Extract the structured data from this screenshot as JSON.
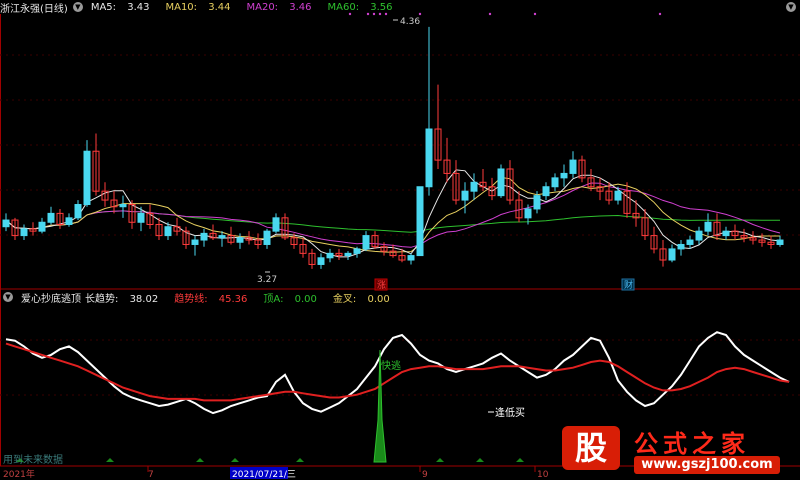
{
  "colors": {
    "up": "#4ad8f0",
    "down": "#ff3b3b",
    "ma5": "#e8e8e8",
    "ma10": "#e8d060",
    "ma20": "#d040d0",
    "ma60": "#2ec02e",
    "white_line": "#ffffff",
    "red_line": "#e02020",
    "signal": "#2ec02e",
    "axis": "#a00000"
  },
  "header": {
    "stock_name": "浙江永强(日线)",
    "ma5_label": "MA5:",
    "ma5_value": "3.43",
    "ma10_label": "MA10:",
    "ma10_value": "3.44",
    "ma20_label": "MA20:",
    "ma20_value": "3.46",
    "ma60_label": "MA60:",
    "ma60_value": "3.56",
    "settings_icon": "chevron-down-icon"
  },
  "price_panel": {
    "high_label": "4.36",
    "low_label": "3.27",
    "markers": [
      {
        "label": "涨"
      },
      {
        "label": "财"
      }
    ]
  },
  "indicator_header": {
    "name": "爱心抄底逃顶",
    "trend_label": "长趋势:",
    "trend_value": "38.02",
    "trendline_label": "趋势线:",
    "trendline_value": "45.36",
    "top_label": "顶A:",
    "top_value": "0.00",
    "gold_label": "金叉:",
    "gold_value": "0.00"
  },
  "indicator_panel": {
    "annotation_fast_escape": "快逃",
    "annotation_buy_low": "逢低买",
    "footer_note": "用到未来数据"
  },
  "x_axis": {
    "labels": [
      {
        "text": "2021年"
      },
      {
        "text": "7"
      },
      {
        "text": "2021/07/21/三",
        "highlight": true
      },
      {
        "text": "9"
      },
      {
        "text": "10"
      }
    ]
  },
  "watermark": {
    "badge": "股",
    "title": "公式之家",
    "url": "www.gszj100.com"
  },
  "chart_data": [
    {
      "type": "candlestick",
      "title": "浙江永强(日线)",
      "labeled_points": {
        "high": 4.36,
        "low": 3.27
      },
      "moving_averages": {
        "MA5": 3.43,
        "MA10": 3.44,
        "MA20": 3.46,
        "MA60": 3.56
      },
      "ohlc": [
        [
          3.46,
          3.52,
          3.44,
          3.49
        ],
        [
          3.49,
          3.5,
          3.4,
          3.42
        ],
        [
          3.42,
          3.47,
          3.4,
          3.45
        ],
        [
          3.45,
          3.48,
          3.42,
          3.44
        ],
        [
          3.44,
          3.5,
          3.43,
          3.48
        ],
        [
          3.48,
          3.55,
          3.47,
          3.52
        ],
        [
          3.52,
          3.54,
          3.45,
          3.47
        ],
        [
          3.47,
          3.52,
          3.46,
          3.5
        ],
        [
          3.5,
          3.58,
          3.49,
          3.56
        ],
        [
          3.56,
          3.85,
          3.55,
          3.8
        ],
        [
          3.8,
          3.88,
          3.6,
          3.62
        ],
        [
          3.62,
          3.66,
          3.55,
          3.58
        ],
        [
          3.58,
          3.62,
          3.52,
          3.55
        ],
        [
          3.55,
          3.6,
          3.5,
          3.56
        ],
        [
          3.56,
          3.58,
          3.45,
          3.48
        ],
        [
          3.48,
          3.55,
          3.44,
          3.52
        ],
        [
          3.52,
          3.56,
          3.45,
          3.47
        ],
        [
          3.47,
          3.5,
          3.4,
          3.42
        ],
        [
          3.42,
          3.48,
          3.4,
          3.46
        ],
        [
          3.46,
          3.5,
          3.42,
          3.44
        ],
        [
          3.44,
          3.46,
          3.36,
          3.38
        ],
        [
          3.38,
          3.42,
          3.33,
          3.4
        ],
        [
          3.4,
          3.45,
          3.37,
          3.43
        ],
        [
          3.43,
          3.47,
          3.4,
          3.41
        ],
        [
          3.41,
          3.44,
          3.37,
          3.42
        ],
        [
          3.42,
          3.46,
          3.38,
          3.39
        ],
        [
          3.39,
          3.43,
          3.36,
          3.41
        ],
        [
          3.41,
          3.44,
          3.38,
          3.4
        ],
        [
          3.4,
          3.43,
          3.36,
          3.38
        ],
        [
          3.38,
          3.45,
          3.36,
          3.44
        ],
        [
          3.44,
          3.52,
          3.43,
          3.5
        ],
        [
          3.5,
          3.52,
          3.4,
          3.41
        ],
        [
          3.41,
          3.43,
          3.36,
          3.38
        ],
        [
          3.38,
          3.41,
          3.32,
          3.34
        ],
        [
          3.34,
          3.36,
          3.27,
          3.29
        ],
        [
          3.29,
          3.34,
          3.27,
          3.32
        ],
        [
          3.32,
          3.36,
          3.3,
          3.34
        ],
        [
          3.34,
          3.36,
          3.31,
          3.33
        ],
        [
          3.33,
          3.35,
          3.31,
          3.34
        ],
        [
          3.34,
          3.37,
          3.32,
          3.36
        ],
        [
          3.36,
          3.44,
          3.35,
          3.42
        ],
        [
          3.42,
          3.44,
          3.36,
          3.37
        ],
        [
          3.37,
          3.39,
          3.33,
          3.35
        ],
        [
          3.35,
          3.38,
          3.32,
          3.33
        ],
        [
          3.33,
          3.36,
          3.3,
          3.31
        ],
        [
          3.31,
          3.34,
          3.29,
          3.33
        ],
        [
          3.33,
          3.64,
          3.33,
          3.64
        ],
        [
          3.64,
          4.36,
          3.6,
          3.9
        ],
        [
          3.9,
          4.1,
          3.72,
          3.76
        ],
        [
          3.76,
          3.86,
          3.66,
          3.7
        ],
        [
          3.7,
          3.76,
          3.56,
          3.58
        ],
        [
          3.58,
          3.66,
          3.52,
          3.62
        ],
        [
          3.62,
          3.7,
          3.58,
          3.66
        ],
        [
          3.66,
          3.72,
          3.62,
          3.64
        ],
        [
          3.64,
          3.68,
          3.58,
          3.6
        ],
        [
          3.6,
          3.74,
          3.59,
          3.72
        ],
        [
          3.72,
          3.76,
          3.56,
          3.58
        ],
        [
          3.58,
          3.62,
          3.48,
          3.5
        ],
        [
          3.5,
          3.56,
          3.47,
          3.54
        ],
        [
          3.54,
          3.62,
          3.52,
          3.6
        ],
        [
          3.6,
          3.66,
          3.58,
          3.64
        ],
        [
          3.64,
          3.7,
          3.62,
          3.68
        ],
        [
          3.68,
          3.74,
          3.64,
          3.7
        ],
        [
          3.7,
          3.8,
          3.68,
          3.76
        ],
        [
          3.76,
          3.78,
          3.66,
          3.68
        ],
        [
          3.68,
          3.72,
          3.62,
          3.64
        ],
        [
          3.64,
          3.68,
          3.58,
          3.62
        ],
        [
          3.62,
          3.66,
          3.56,
          3.58
        ],
        [
          3.58,
          3.64,
          3.56,
          3.62
        ],
        [
          3.62,
          3.66,
          3.5,
          3.52
        ],
        [
          3.52,
          3.58,
          3.46,
          3.5
        ],
        [
          3.5,
          3.54,
          3.4,
          3.42
        ],
        [
          3.42,
          3.46,
          3.34,
          3.36
        ],
        [
          3.36,
          3.4,
          3.28,
          3.31
        ],
        [
          3.31,
          3.38,
          3.3,
          3.36
        ],
        [
          3.36,
          3.4,
          3.33,
          3.38
        ],
        [
          3.38,
          3.42,
          3.36,
          3.4
        ],
        [
          3.4,
          3.46,
          3.38,
          3.44
        ],
        [
          3.44,
          3.52,
          3.42,
          3.48
        ],
        [
          3.48,
          3.52,
          3.4,
          3.42
        ],
        [
          3.42,
          3.46,
          3.4,
          3.44
        ],
        [
          3.44,
          3.47,
          3.4,
          3.42
        ],
        [
          3.42,
          3.45,
          3.39,
          3.41
        ],
        [
          3.41,
          3.44,
          3.38,
          3.4
        ],
        [
          3.4,
          3.43,
          3.37,
          3.39
        ],
        [
          3.39,
          3.42,
          3.36,
          3.38
        ],
        [
          3.38,
          3.42,
          3.37,
          3.4
        ]
      ]
    },
    {
      "type": "line",
      "title": "爱心抄底逃顶",
      "series": [
        {
          "name": "长趋势",
          "values": [
            85,
            84,
            80,
            75,
            72,
            74,
            78,
            80,
            76,
            70,
            64,
            58,
            52,
            47,
            44,
            42,
            40,
            38,
            39,
            41,
            43,
            40,
            36,
            33,
            35,
            38,
            40,
            42,
            44,
            45,
            55,
            60,
            48,
            40,
            36,
            34,
            37,
            40,
            45,
            50,
            58,
            66,
            78,
            86,
            88,
            82,
            74,
            70,
            68,
            64,
            62,
            64,
            66,
            68,
            72,
            75,
            70,
            66,
            62,
            58,
            60,
            64,
            70,
            74,
            80,
            86,
            84,
            72,
            56,
            48,
            42,
            38,
            40,
            46,
            52,
            60,
            70,
            80,
            86,
            90,
            88,
            80,
            74,
            70,
            66,
            62,
            58,
            55
          ],
          "last": 38.02
        },
        {
          "name": "趋势线",
          "values": [
            82,
            80,
            78,
            76,
            74,
            72,
            70,
            68,
            66,
            63,
            60,
            57,
            54,
            51,
            49,
            47,
            45,
            44,
            43,
            43,
            43,
            43,
            42,
            42,
            42,
            42,
            43,
            44,
            45,
            46,
            47,
            48,
            48,
            47,
            46,
            45,
            44,
            44,
            45,
            46,
            48,
            50,
            54,
            58,
            62,
            64,
            65,
            66,
            66,
            65,
            64,
            64,
            64,
            64,
            65,
            66,
            66,
            66,
            65,
            64,
            63,
            63,
            64,
            65,
            67,
            69,
            70,
            69,
            66,
            62,
            58,
            54,
            51,
            49,
            49,
            50,
            52,
            55,
            58,
            62,
            64,
            65,
            64,
            62,
            60,
            58,
            56,
            55
          ],
          "last": 45.36
        }
      ]
    }
  ]
}
